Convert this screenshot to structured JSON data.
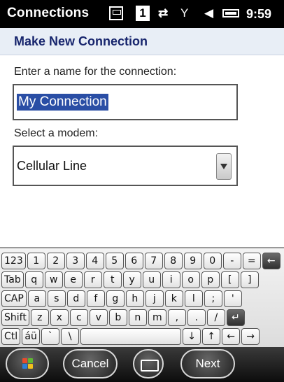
{
  "status_bar": {
    "title": "Connections",
    "notification_count": "1",
    "time": "9:59",
    "icons": [
      "window-icon",
      "data-icon",
      "signal-icon",
      "sound-icon",
      "battery-icon"
    ]
  },
  "page": {
    "heading": "Make New Connection",
    "name_label": "Enter a name for the connection:",
    "name_value": "My Connection",
    "modem_label": "Select a modem:",
    "modem_value": "Cellular Line"
  },
  "keyboard": {
    "rows": [
      [
        "123",
        "1",
        "2",
        "3",
        "4",
        "5",
        "6",
        "7",
        "8",
        "9",
        "0",
        "-",
        "=",
        "←"
      ],
      [
        "Tab",
        "q",
        "w",
        "e",
        "r",
        "t",
        "y",
        "u",
        "i",
        "o",
        "p",
        "[",
        "]"
      ],
      [
        "CAP",
        "a",
        "s",
        "d",
        "f",
        "g",
        "h",
        "j",
        "k",
        "l",
        ";",
        "'"
      ],
      [
        "Shift",
        "z",
        "x",
        "c",
        "v",
        "b",
        "n",
        "m",
        ",",
        ".",
        "/",
        "↵"
      ],
      [
        "Ctl",
        "áü",
        "`",
        "\\",
        " ",
        "↓",
        "↑",
        "←",
        "→"
      ]
    ]
  },
  "bottom_bar": {
    "cancel_label": "Cancel",
    "next_label": "Next"
  }
}
